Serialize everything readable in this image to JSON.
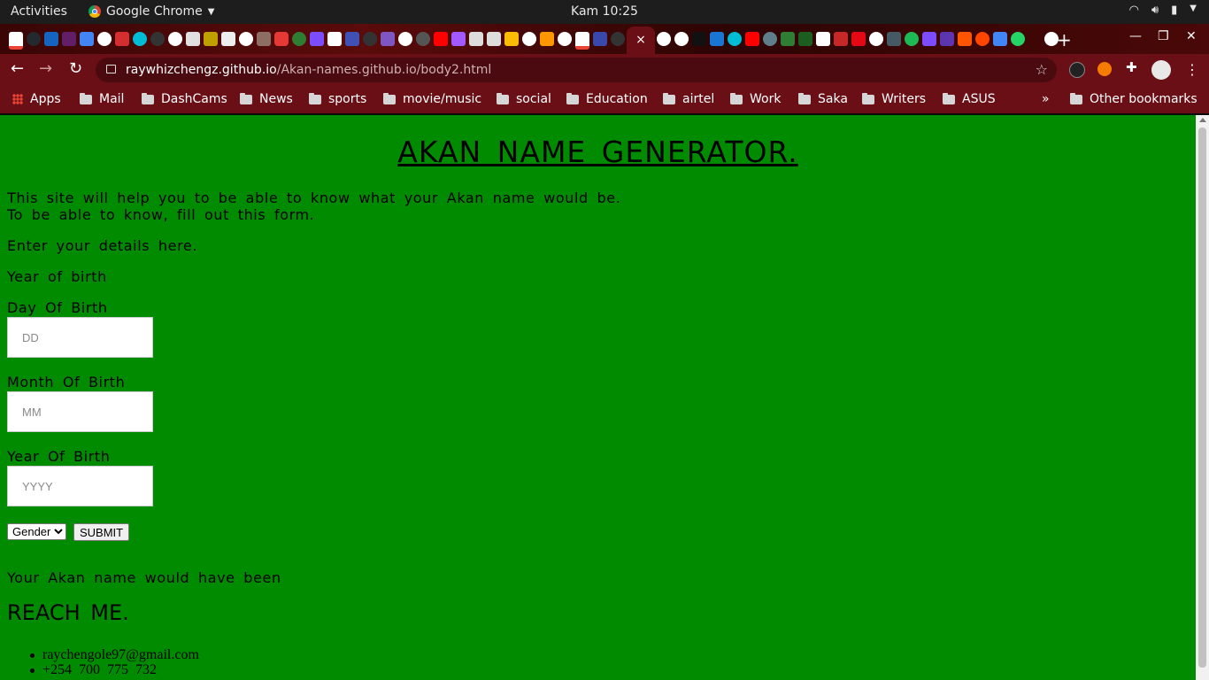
{
  "topbar": {
    "activities": "Activities",
    "app_name": "Google Chrome",
    "clock": "Kam 10:25"
  },
  "tabs": {
    "active_close": "×",
    "new_tab": "+"
  },
  "omnibox": {
    "host": "raywhizchengz.github.io",
    "path": "/Akan-names.github.io/body2.html"
  },
  "bookmarks": {
    "apps": "Apps",
    "items": [
      "Mail",
      "DashCams",
      "News",
      "sports",
      "movie/music",
      "social",
      "Education",
      "airtel",
      "Work",
      "Saka",
      "Writers",
      "ASUS"
    ],
    "overflow": "»",
    "other": "Other bookmarks"
  },
  "page": {
    "title": "AKAN NAME GENERATOR.",
    "intro_line1": "This site will help you to be able to know what your Akan name would be.",
    "intro_line2": "To be able to know, fill out this form.",
    "enter_details": "Enter your details here.",
    "year_of_birth_heading": "Year of birth",
    "day_label": "Day Of Birth",
    "day_placeholder": "DD",
    "month_label": "Month Of Birth",
    "month_placeholder": "MM",
    "year_label": "Year Of Birth",
    "year_placeholder": "YYYY",
    "gender_selected": "Gender",
    "submit_label": "SUBMIT",
    "result_text": "Your Akan name would have been",
    "reach_heading": "REACH ME.",
    "contacts": [
      "raychengole97@gmail.com",
      "+254 700 775 732"
    ]
  },
  "colors": {
    "page_background": "#008b00",
    "chrome_theme": "#6b0f16"
  }
}
